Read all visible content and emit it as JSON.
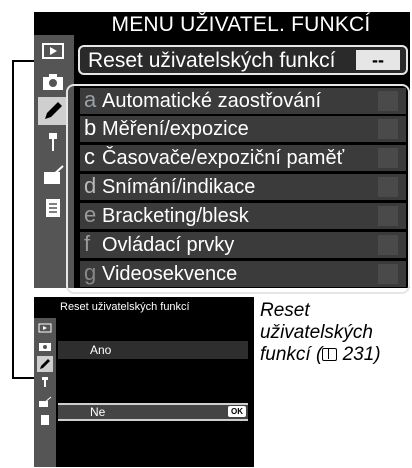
{
  "main_menu": {
    "title": "MENU UŽIVATEL. FUNKCÍ",
    "reset_item": {
      "label": "Reset uživatelských funkcí",
      "value": "--"
    },
    "banks": [
      {
        "letter": "a",
        "label": "Automatické zaostřování"
      },
      {
        "letter": "b",
        "label": "Měření/expozice"
      },
      {
        "letter": "c",
        "label": "Časovače/expoziční paměť"
      },
      {
        "letter": "d",
        "label": "Snímání/indikace"
      },
      {
        "letter": "e",
        "label": "Bracketing/blesk"
      },
      {
        "letter": "f",
        "label": "Ovládací prvky"
      },
      {
        "letter": "g",
        "label": "Videosekvence"
      }
    ],
    "tabs": [
      "playback-icon",
      "camera-icon",
      "pencil-icon",
      "wrench-icon",
      "retouch-icon",
      "my-menu-icon"
    ]
  },
  "sub_screen": {
    "title": "Reset uživatelských funkcí",
    "options": [
      {
        "label": "Ano"
      },
      {
        "label": "Ne",
        "badge": "OK"
      }
    ]
  },
  "caption": {
    "text": "Reset uživatelských funkcí (",
    "page_ref": "231)"
  },
  "colors": {
    "screen_bg": "#000000",
    "highlight": "#e6e6e6",
    "row_bg": "#3b3b3b"
  }
}
